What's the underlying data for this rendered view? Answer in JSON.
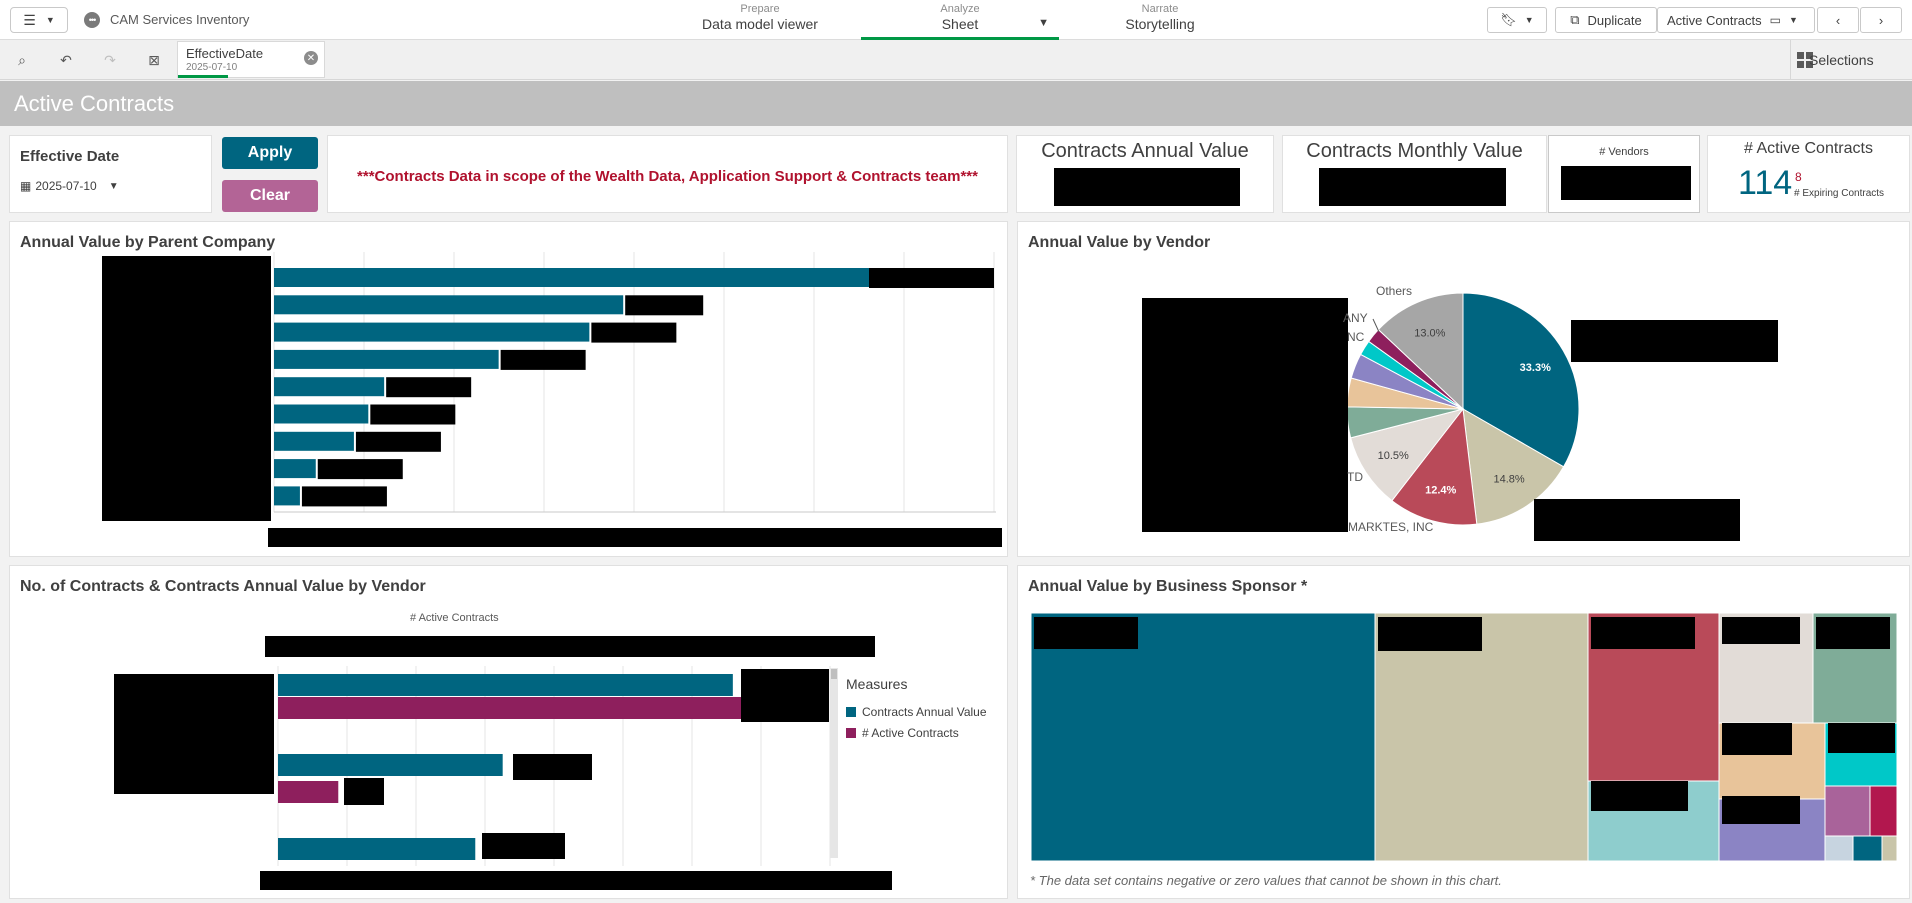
{
  "app": {
    "name": "CAM Services Inventory",
    "tabs": [
      {
        "sub": "Prepare",
        "main": "Data model viewer"
      },
      {
        "sub": "Analyze",
        "main": "Sheet"
      },
      {
        "sub": "Narrate",
        "main": "Storytelling"
      }
    ],
    "duplicate_label": "Duplicate",
    "sheet_selector": "Active Contracts"
  },
  "selections": {
    "field": "EffectiveDate",
    "value": "2025-07-10",
    "button_label": "Selections"
  },
  "sheet": {
    "title": "Active Contracts"
  },
  "filter": {
    "title": "Effective Date",
    "value": "2025-07-10",
    "apply_label": "Apply",
    "clear_label": "Clear"
  },
  "banner": {
    "text": "***Contracts Data in scope of the Wealth Data, Application Support & Contracts team***"
  },
  "kpis": {
    "annual_value_title": "Contracts Annual Value",
    "monthly_value_title": "Contracts Monthly Value",
    "vendors_title": "# Vendors",
    "active_title": "# Active Contracts",
    "active_value": "114",
    "expiring_value": "8",
    "expiring_label": "# Expiring Contracts"
  },
  "charts": {
    "parent_company_title": "Annual Value by Parent Company",
    "vendor_pie_title": "Annual Value by Vendor",
    "combo_title": "No. of Contracts & Contracts Annual Value by Vendor",
    "combo_axis_title": "# Active Contracts",
    "treemap_title": "Annual Value by Business Sponsor *",
    "treemap_footnote": "* The data set contains negative or zero values that cannot be shown in this chart.",
    "legend_title": "Measures",
    "legend_items": [
      {
        "label": "Contracts Annual Value",
        "color": "#006580"
      },
      {
        "label": "# Active Contracts",
        "color": "#8e1f5d"
      }
    ],
    "pie_labels": {
      "others": "Others",
      "any": "ANY",
      "nc": "NC",
      "ltd": "TD",
      "markets": "MARKTES, INC"
    }
  },
  "chart_data": [
    {
      "type": "bar",
      "title": "Annual Value by Parent Company",
      "orientation": "horizontal",
      "relative_values": [
        100,
        48.5,
        43.8,
        31.2,
        15.3,
        13.1,
        11.1,
        5.8,
        3.6
      ],
      "color": "#006580"
    },
    {
      "type": "pie",
      "title": "Annual Value by Vendor",
      "slices": [
        {
          "label": "",
          "value": 33.3,
          "display": "33.3%",
          "color": "#006580"
        },
        {
          "label": "",
          "value": 14.8,
          "display": "14.8%",
          "color": "#c9c5a9"
        },
        {
          "label": "MARKTES, INC",
          "value": 12.4,
          "display": "12.4%",
          "color": "#b94a59"
        },
        {
          "label": "TD",
          "value": 10.5,
          "display": "10.5%",
          "color": "#e2dcd7"
        },
        {
          "label": "",
          "value": 4.3,
          "display": "",
          "color": "#7fac98"
        },
        {
          "label": "",
          "value": 4.0,
          "display": "",
          "color": "#e8c49a"
        },
        {
          "label": "",
          "value": 3.5,
          "display": "",
          "color": "#8b84c4"
        },
        {
          "label": "NC",
          "value": 2.1,
          "display": "",
          "color": "#00c8c8"
        },
        {
          "label": "ANY",
          "value": 2.1,
          "display": "",
          "color": "#8e1f5d"
        },
        {
          "label": "Others",
          "value": 13.0,
          "display": "13.0%",
          "color": "#a6a6a6"
        }
      ]
    },
    {
      "type": "bar",
      "title": "No. of Contracts & Contracts Annual Value by Vendor",
      "series": [
        {
          "name": "Contracts Annual Value",
          "color": "#006580",
          "relative_values": [
            83,
            41,
            36
          ]
        },
        {
          "name": "# Active Contracts",
          "color": "#8e1f5d",
          "relative_values": [
            100,
            11,
            0
          ]
        }
      ]
    },
    {
      "type": "treemap",
      "title": "Annual Value by Business Sponsor *"
    }
  ]
}
